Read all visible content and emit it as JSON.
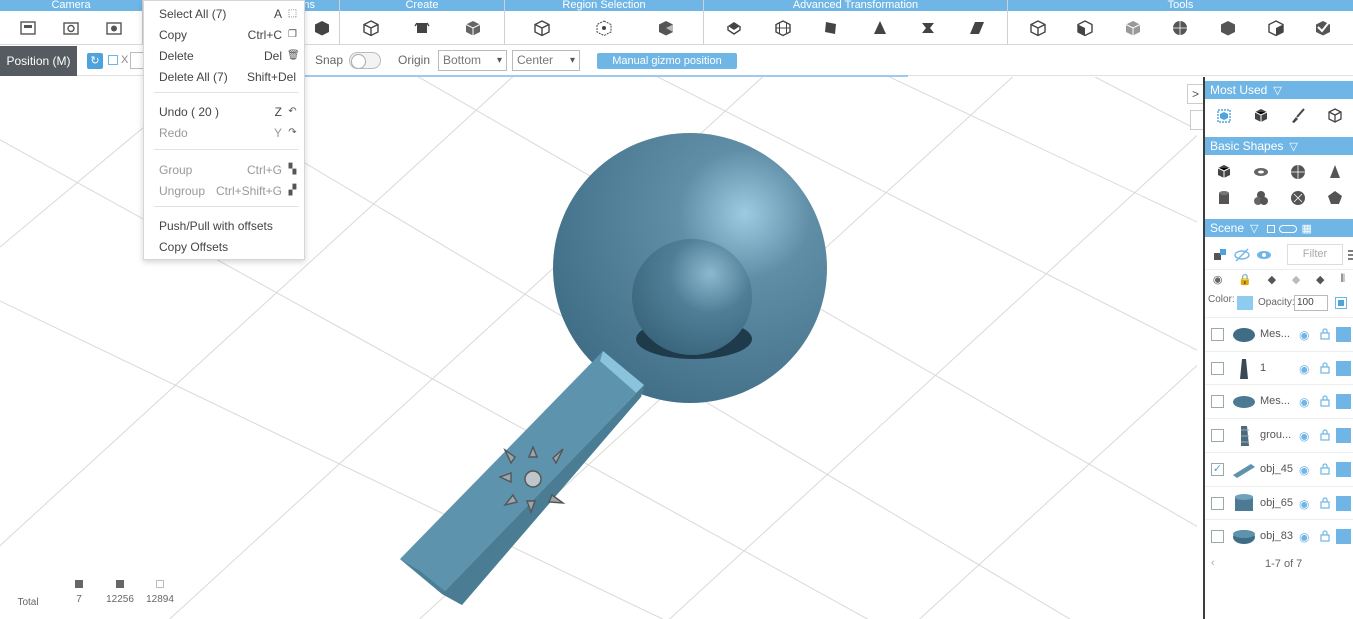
{
  "ribbon": {
    "groups": [
      {
        "label": "Camera"
      },
      {
        "label": "ns"
      },
      {
        "label": "Create"
      },
      {
        "label": "Region Selection"
      },
      {
        "label": "Advanced Transformation"
      },
      {
        "label": "Tools"
      }
    ]
  },
  "toolbar": {
    "mode_label": "Position (M)",
    "axis_label": "X",
    "snap_label": "Snap",
    "origin_label": "Origin",
    "origin_vertical": "Bottom",
    "origin_horizontal": "Center",
    "manual_gizmo_label": "Manual gizmo position"
  },
  "context_menu": {
    "items": [
      {
        "label": "Select All (7)",
        "shortcut": "A"
      },
      {
        "label": "Copy",
        "shortcut": "Ctrl+C"
      },
      {
        "label": "Delete",
        "shortcut": "Del"
      },
      {
        "label": "Delete All (7)",
        "shortcut": "Shift+Del"
      },
      {
        "label": "Undo  ( 20 )",
        "shortcut": "Z"
      },
      {
        "label": "Redo",
        "shortcut": "Y"
      },
      {
        "label": "Group",
        "shortcut": "Ctrl+G"
      },
      {
        "label": "Ungroup",
        "shortcut": "Ctrl+Shift+G"
      },
      {
        "label": "Push/Pull with offsets",
        "shortcut": ""
      },
      {
        "label": "Copy Offsets",
        "shortcut": ""
      }
    ]
  },
  "stats": {
    "total_label": "Total",
    "objects": "7",
    "vertices": "12256",
    "faces": "12894"
  },
  "panel": {
    "most_used_label": "Most Used",
    "basic_shapes_label": "Basic Shapes",
    "scene_label": "Scene",
    "filter_placeholder": "Filter",
    "color_label": "Color:",
    "opacity_label": "Opacity:",
    "opacity_value": "100",
    "color_value": "#8ecbf1",
    "scene_items": [
      {
        "name": "Mes...",
        "checked": false
      },
      {
        "name": "1",
        "checked": false
      },
      {
        "name": "Mes...",
        "checked": false
      },
      {
        "name": "grou...",
        "checked": false
      },
      {
        "name": "obj_45",
        "checked": true
      },
      {
        "name": "obj_65",
        "checked": false
      },
      {
        "name": "obj_83",
        "checked": false
      }
    ],
    "count_label": "1-7 of 7"
  },
  "colors": {
    "accent": "#6fb6e6",
    "model": "#4c7a92"
  }
}
